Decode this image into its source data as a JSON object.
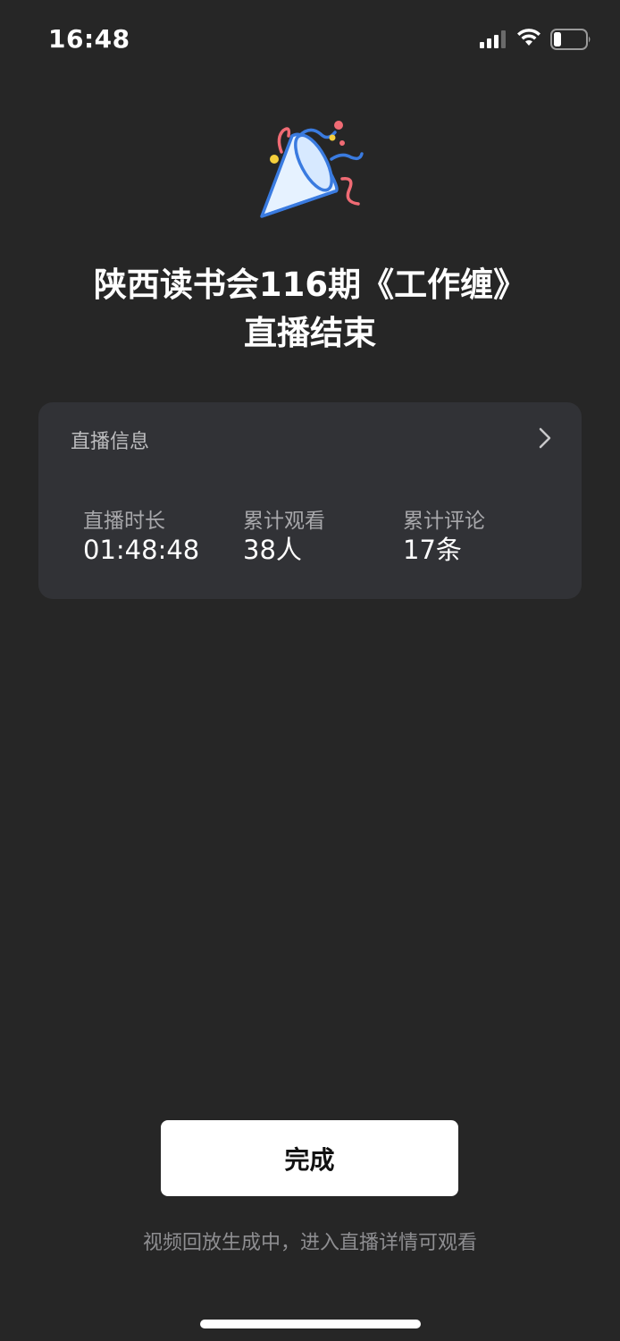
{
  "status_bar": {
    "time": "16:48",
    "signal_icon": "cellular-signal-icon",
    "wifi_icon": "wifi-icon",
    "battery_icon": "battery-icon"
  },
  "hero": {
    "icon": "party-popper-icon",
    "title_line1": "陕西读书会116期《工作缠》",
    "title_line2": "直播结束"
  },
  "info_card": {
    "header": "直播信息",
    "chevron_icon": "chevron-right-icon",
    "stats": [
      {
        "label": "直播时长",
        "value": "01:48:48"
      },
      {
        "label": "累计观看",
        "value": "38人"
      },
      {
        "label": "累计评论",
        "value": "17条"
      }
    ]
  },
  "actions": {
    "done_label": "完成"
  },
  "footer": {
    "note": "视频回放生成中，进入直播详情可观看"
  },
  "colors": {
    "background": "#262626",
    "card": "#313236",
    "button": "#ffffff",
    "accent_blue": "#3a7be0",
    "accent_pink": "#f06b74",
    "accent_yellow": "#f5cf3b"
  }
}
